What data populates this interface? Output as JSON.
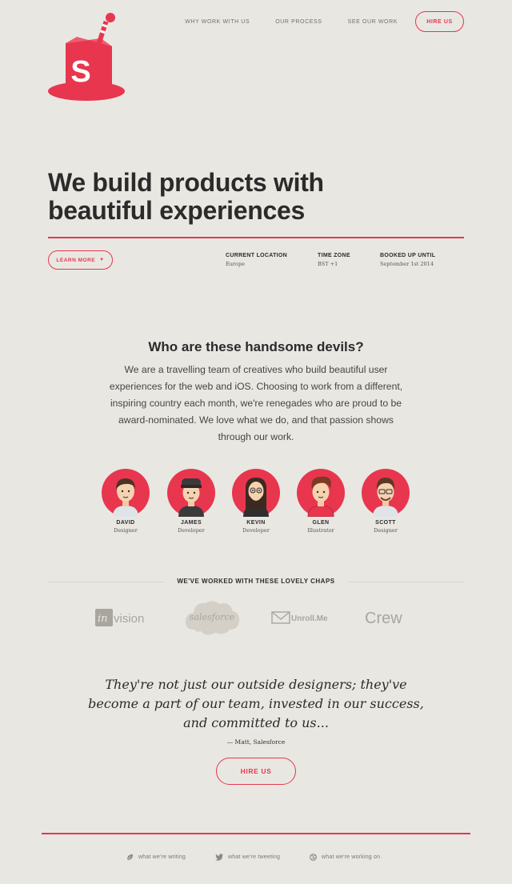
{
  "nav": {
    "links": [
      "WHY WORK WITH US",
      "OUR PROCESS",
      "SEE OUR WORK"
    ],
    "cta": "HIRE US"
  },
  "hero": {
    "title_line1": "We build products with",
    "title_line2": "beautiful experiences",
    "learn_more": "LEARN MORE",
    "meta": [
      {
        "label": "CURRENT LOCATION",
        "value": "Europe"
      },
      {
        "label": "TIME ZONE",
        "value": "BST +1"
      },
      {
        "label": "BOOKED UP UNTIL",
        "value": "September 1st 2014"
      }
    ]
  },
  "about": {
    "title": "Who are these handsome devils?",
    "text": "We are a travelling team of creatives who build beautiful user experiences for the web and iOS. Choosing to work from a different, inspiring country each month, we're renegades who are proud to be award-nominated. We love what we do, and that passion shows through our work."
  },
  "team": [
    {
      "name": "DAVID",
      "role": "Designer"
    },
    {
      "name": "JAMES",
      "role": "Developer"
    },
    {
      "name": "KEVIN",
      "role": "Developer"
    },
    {
      "name": "GLEN",
      "role": "Illustrator"
    },
    {
      "name": "SCOTT",
      "role": "Designer"
    }
  ],
  "clients": {
    "title": "WE'VE WORKED WITH THESE LOVELY CHAPS",
    "logos": [
      "InVision",
      "salesforce",
      "Unroll.Me",
      "Crew"
    ]
  },
  "testimonial": {
    "quote": "They're not just our outside designers; they've become a part of our team, invested in our success, and committed to us...",
    "author": "— Matt, Salesforce",
    "cta": "HIRE US"
  },
  "footer": {
    "links": [
      "what we're writing",
      "what we're tweeting",
      "what we're working on"
    ]
  },
  "colors": {
    "accent": "#e8364f",
    "background": "#e9e7e2",
    "text": "#2c2c2c"
  }
}
